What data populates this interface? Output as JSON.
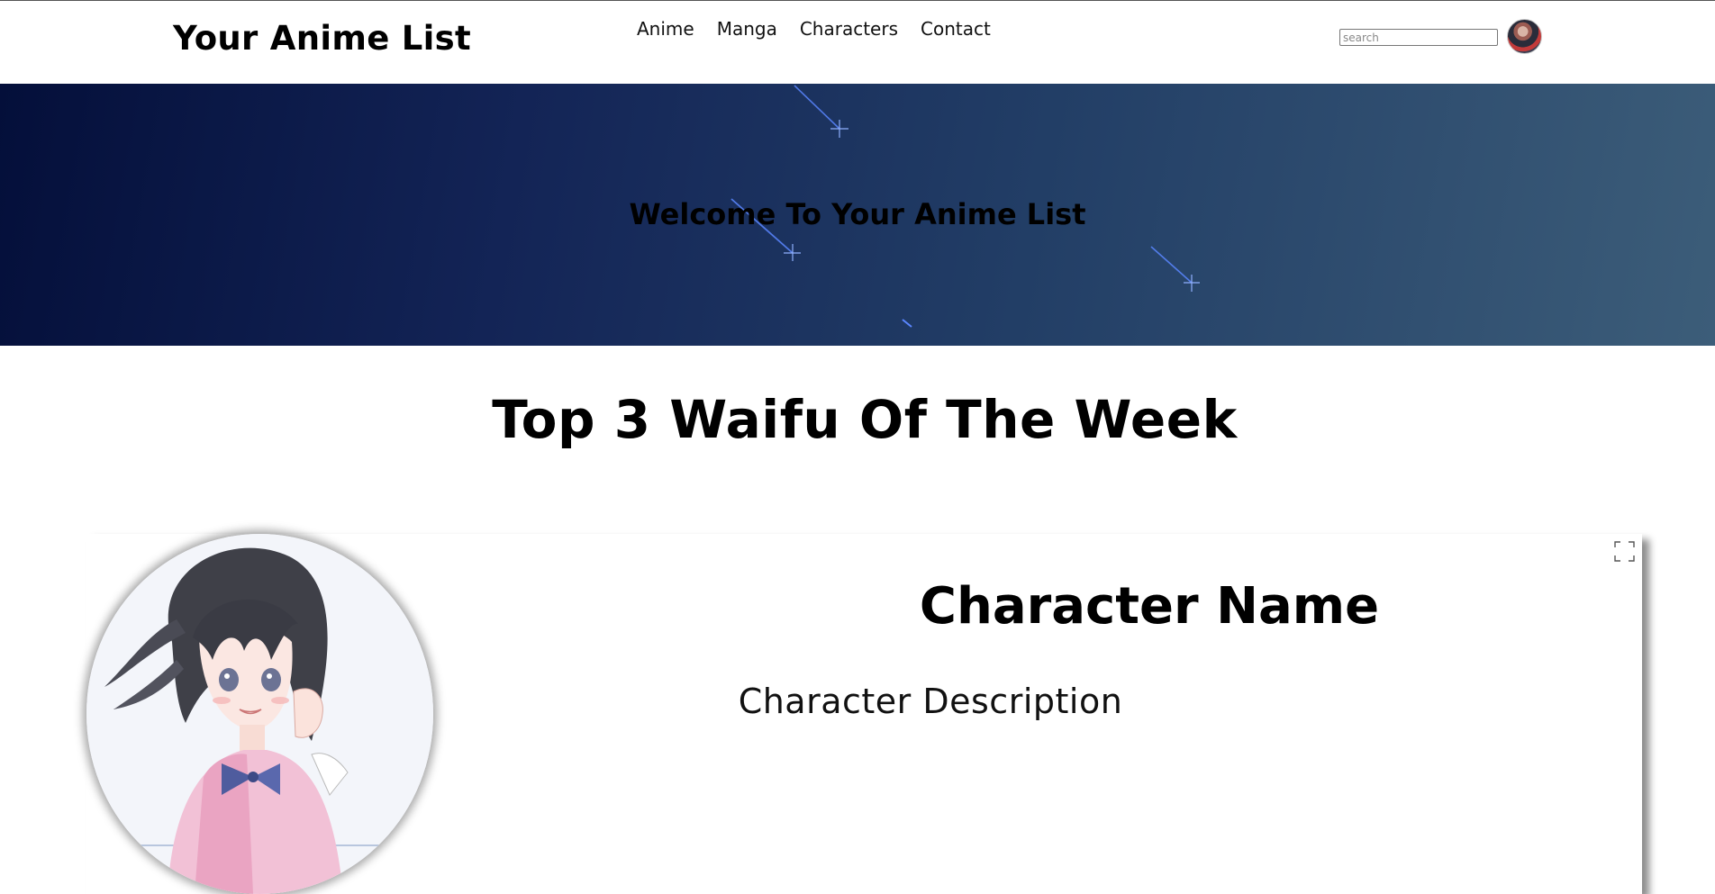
{
  "header": {
    "brand": "Your Anime List",
    "nav": [
      "Anime",
      "Manga",
      "Characters",
      "Contact"
    ],
    "search_placeholder": "search"
  },
  "hero": {
    "title": "Welcome To Your Anime List"
  },
  "section": {
    "title": "Top 3 Waifu Of The Week"
  },
  "card": {
    "name": "Character Name",
    "description": "Character Description"
  },
  "icons": {
    "expand": "expand-icon",
    "avatar": "avatar",
    "star": "shooting-star-icon"
  },
  "colors": {
    "hero_start": "#040f3a",
    "hero_end": "#3c5d79",
    "star": "#5a86ff"
  }
}
